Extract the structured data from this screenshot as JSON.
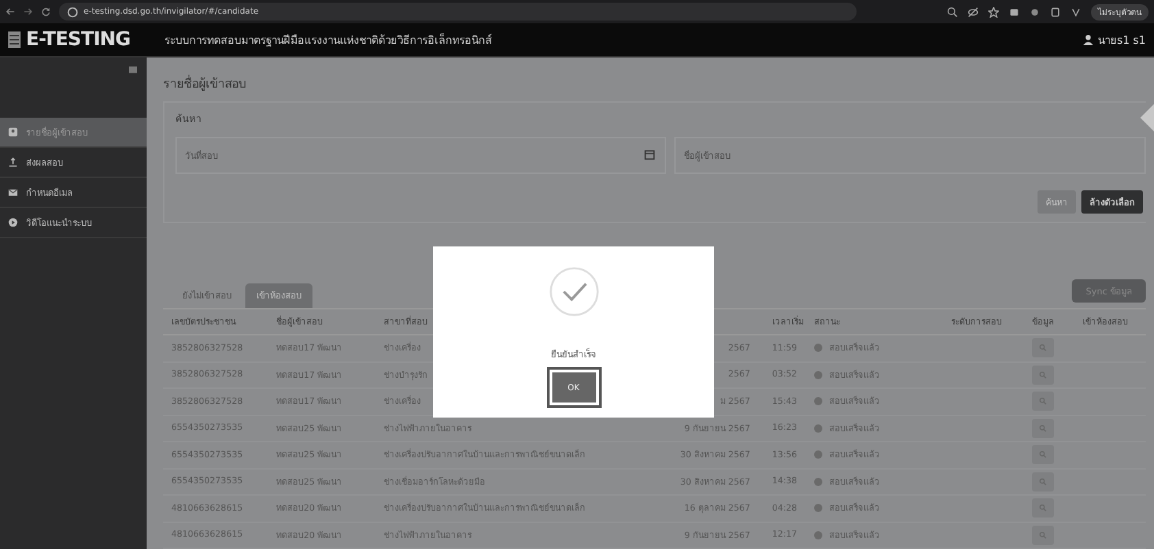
{
  "browser": {
    "url": "e-testing.dsd.go.th/invigilator/#/candidate",
    "profile": "ไม่ระบุตัวตน"
  },
  "header": {
    "logo": "E-TESTING",
    "title": "ระบบการทดสอบมาตรฐานฝีมือแรงงานแห่งชาติด้วยวิธีการอิเล็กทรอนิกส์",
    "user": "นายs1 s1"
  },
  "sidebar": {
    "items": [
      {
        "label": "รายชื่อผู้เข้าสอบ",
        "kind": "list",
        "selected": true
      },
      {
        "label": "ส่งผลสอบ",
        "kind": "upload",
        "selected": false
      },
      {
        "label": "กำหนดอีเมล",
        "kind": "mail",
        "selected": false
      },
      {
        "label": "วิดีโอแนะนำระบบ",
        "kind": "play",
        "selected": false
      }
    ]
  },
  "page_title": "รายชื่อผู้เข้าสอบ",
  "search": {
    "title": "ค้นหา",
    "date_placeholder": "วันที่สอบ",
    "name_placeholder": "ชื่อผู้เข้าสอบ",
    "buttons": [
      "ค้นหา",
      "ล้างตัวเลือก"
    ]
  },
  "tabs": [
    {
      "label": "ยังไม่เข้าสอบ",
      "selected": false
    },
    {
      "label": "เข้าห้องสอบ",
      "selected": true
    }
  ],
  "sync_button": "Sync ข้อมูล",
  "table": {
    "columns": [
      "เลขบัตรประชาชน",
      "ชื่อผู้เข้าสอบ",
      "สาขาที่สอบ",
      "",
      "เวลาเริ่ม",
      "สถานะ",
      "ระดับการสอบ",
      "ข้อมูล",
      "เข้าห้องสอบ"
    ],
    "rows": [
      {
        "id": "3852806327528",
        "name": "ทดสอบ17 พัฒนา",
        "branch": "ช่างเครื่อง",
        "date": "2567",
        "time": "11:59",
        "status": "สอบเสร็จแล้ว"
      },
      {
        "id": "3852806327528",
        "name": "ทดสอบ17 พัฒนา",
        "branch": "ช่างบำรุงรัก",
        "date": "2567",
        "time": "03:52",
        "status": "สอบเสร็จแล้ว"
      },
      {
        "id": "3852806327528",
        "name": "ทดสอบ17 พัฒนา",
        "branch": "ช่างเครื่อง",
        "date": "ม 2567",
        "time": "15:43",
        "status": "สอบเสร็จแล้ว"
      },
      {
        "id": "6554350273535",
        "name": "ทดสอบ25 พัฒนา",
        "branch": "ช่างไฟฟ้าภายในอาคาร",
        "date": "9 กันยายน 2567",
        "time": "16:23",
        "status": "สอบเสร็จแล้ว"
      },
      {
        "id": "6554350273535",
        "name": "ทดสอบ25 พัฒนา",
        "branch": "ช่างเครื่องปรับอากาศในบ้านและการพาณิชย์ขนาดเล็ก",
        "date": "30 สิงหาคม 2567",
        "time": "13:56",
        "status": "สอบเสร็จแล้ว"
      },
      {
        "id": "6554350273535",
        "name": "ทดสอบ25 พัฒนา",
        "branch": "ช่างเชื่อมอาร์กโลหะด้วยมือ",
        "date": "30 สิงหาคม 2567",
        "time": "14:38",
        "status": "สอบเสร็จแล้ว"
      },
      {
        "id": "4810663628615",
        "name": "ทดสอบ20 พัฒนา",
        "branch": "ช่างเครื่องปรับอากาศในบ้านและการพาณิชย์ขนาดเล็ก",
        "date": "16 ตุลาคม 2567",
        "time": "04:28",
        "status": "สอบเสร็จแล้ว"
      },
      {
        "id": "4810663628615",
        "name": "ทดสอบ20 พัฒนา",
        "branch": "ช่างไฟฟ้าภายในอาคาร",
        "date": "9 กันยายน 2567",
        "time": "12:17",
        "status": "สอบเสร็จแล้ว"
      }
    ]
  },
  "modal": {
    "message": "ยืนยันสำเร็จ",
    "button": "OK"
  }
}
